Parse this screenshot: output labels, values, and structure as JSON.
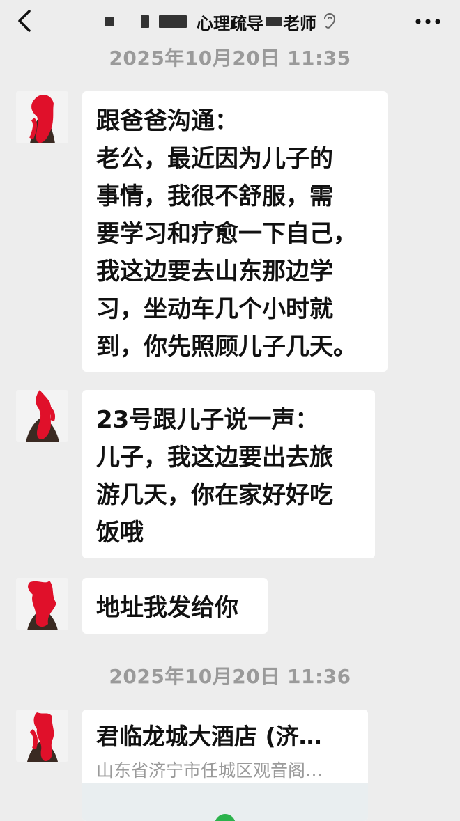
{
  "header": {
    "title": "心理疏导",
    "title_suffix": "老师"
  },
  "timestamps": [
    "2025年10月20日 11:35",
    "2025年10月20日 11:36"
  ],
  "messages": [
    {
      "lines": [
        "跟爸爸沟通：",
        "老公，最近因为儿子的",
        "事情，我很不舒服，需",
        "要学习和疗愈一下自己，",
        "我这边要去山东那边学",
        "习，坐动车几个小时就",
        "到，你先照顾儿子几天。"
      ]
    },
    {
      "lines": [
        "23号跟儿子说一声：",
        "儿子，我这边要出去旅",
        "游几天，你在家好好吃",
        "饭哦"
      ]
    },
    {
      "lines": [
        "地址我发给你"
      ]
    }
  ],
  "location": {
    "name": "君临龙城大酒店 (济…",
    "address": "山东省济宁市任城区观音阁…"
  },
  "colors": {
    "background": "#ededed",
    "bubble": "#ffffff",
    "timestamp": "#9a9a9a",
    "redaction": "#e0102a",
    "map_pin": "#2bb24c"
  },
  "icons": [
    "back-chevron-icon",
    "ear-icon",
    "more-icon",
    "location-pin-icon"
  ]
}
